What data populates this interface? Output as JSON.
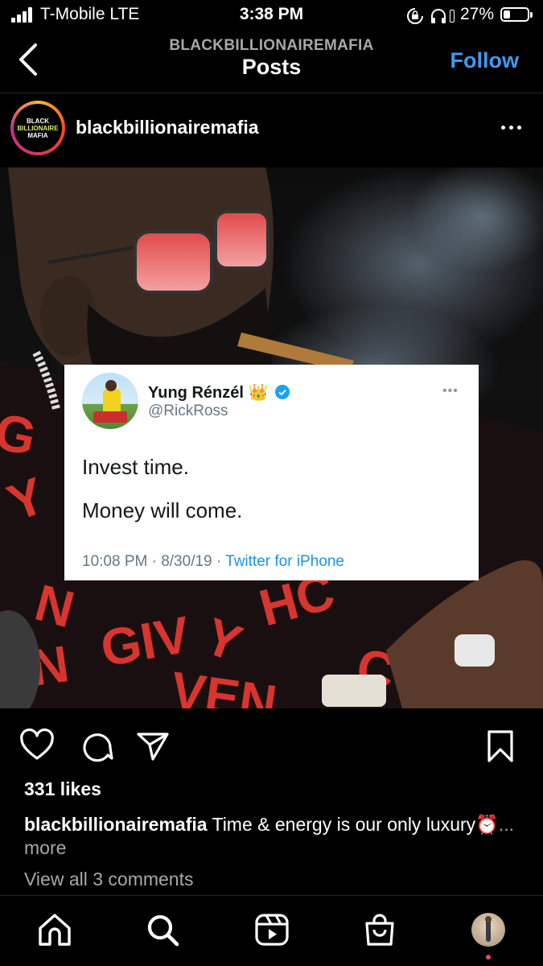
{
  "status_bar": {
    "carrier": "T-Mobile  LTE",
    "time": "3:38 PM",
    "battery_percent": "27%",
    "battery_level": 0.27,
    "icons": [
      "signal-icon",
      "orientation-lock-icon",
      "headphones-icon",
      "battery-icon"
    ]
  },
  "nav": {
    "subtitle": "BLACKBILLIONAIREMAFIA",
    "title": "Posts",
    "follow_label": "Follow",
    "follow_color": "#3d9bf0"
  },
  "post": {
    "username": "blackbillionairemafia",
    "avatar_text": [
      "BLACK",
      "BILLIONAIRE",
      "MAFIA"
    ],
    "tweet": {
      "display_name": "Yung Rénzél 👑",
      "handle": "@RickRoss",
      "line1": "Invest time.",
      "line2": "Money will come.",
      "meta_time": "10:08 PM · 8/30/19 · ",
      "meta_source": "Twitter for iPhone"
    },
    "likes": "331 likes",
    "caption_user": "blackbillionairemafia",
    "caption_text": " Time & energy is our only luxury⏰",
    "caption_more": "... more",
    "view_comments": "View all 3 comments"
  },
  "tab_bar": {
    "items": [
      "home-icon",
      "search-icon",
      "reels-icon",
      "shop-icon",
      "profile-avatar"
    ]
  }
}
